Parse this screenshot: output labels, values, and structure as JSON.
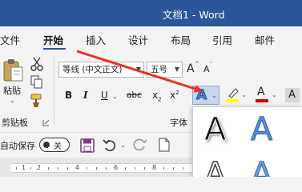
{
  "window": {
    "title": "文档1  -  Word"
  },
  "menu": {
    "tabs": [
      "文件",
      "开始",
      "插入",
      "设计",
      "布局",
      "引用",
      "邮件"
    ],
    "active": "开始"
  },
  "clipboard": {
    "paste_label": "粘贴",
    "group_label": "剪贴板"
  },
  "font": {
    "name": "等线 (中文正文)",
    "size": "五号",
    "grow_label": "A",
    "shrink_label": "A",
    "bold": "B",
    "italic": "I",
    "underline": "U",
    "strike": "abc",
    "subscript": "x",
    "superscript": "x",
    "sub_mark": "2",
    "sup_mark": "2",
    "text_effects": "A",
    "highlight": "A",
    "font_color": "A",
    "char_shading": "A",
    "group_label": "字体"
  },
  "qat": {
    "autosave_label": "自动保存",
    "toggle_label": "关"
  },
  "ruler": {
    "numbers": [
      "1",
      "2",
      "4",
      "6",
      "8"
    ]
  },
  "gallery": {
    "items": [
      "A",
      "A",
      "A",
      "A"
    ]
  },
  "colors": {
    "titlebar": "#2b579a",
    "accent": "#2b579a",
    "annotation_arrow": "#e8302a",
    "highlight_yellow": "#ffff00",
    "font_red": "#d10000"
  }
}
